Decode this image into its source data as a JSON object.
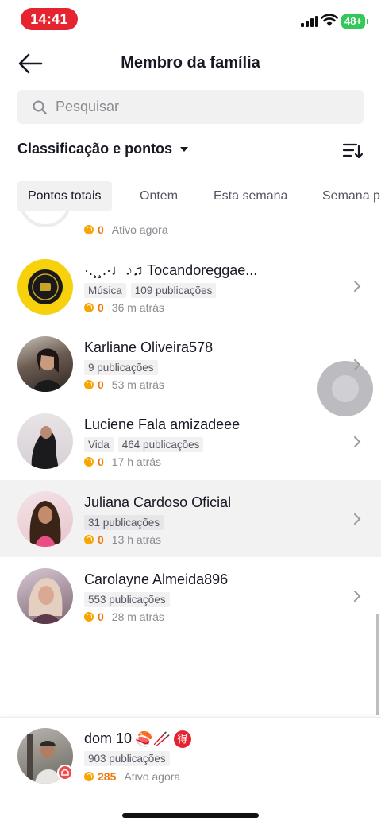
{
  "status_bar": {
    "time": "14:41",
    "battery": "48+"
  },
  "header": {
    "title": "Membro da família"
  },
  "search": {
    "placeholder": "Pesquisar"
  },
  "sort": {
    "label": "Classificação e pontos"
  },
  "tabs": [
    {
      "label": "Pontos totais",
      "active": true
    },
    {
      "label": "Ontem"
    },
    {
      "label": "Esta semana"
    },
    {
      "label": "Semana p"
    }
  ],
  "partial_row": {
    "points": "0",
    "activity": "Ativo agora"
  },
  "members": [
    {
      "name": "·.¸¸.·♩♪♫ Tocandoreggae...",
      "tags": [
        "Música",
        "109 publicações"
      ],
      "points": "0",
      "activity": "36 m atrás",
      "highlight": false
    },
    {
      "name": "Karliane Oliveira578",
      "tags": [
        "9 publicações"
      ],
      "points": "0",
      "activity": "53 m atrás",
      "highlight": false
    },
    {
      "name": "Luciene Fala amizadeee",
      "tags": [
        "Vida",
        "464 publicações"
      ],
      "points": "0",
      "activity": "17 h atrás",
      "highlight": false
    },
    {
      "name": "Juliana Cardoso Oficial",
      "tags": [
        "31 publicações"
      ],
      "points": "0",
      "activity": "13 h atrás",
      "highlight": true
    },
    {
      "name": "Carolayne Almeida896",
      "tags": [
        "553 publicações"
      ],
      "points": "0",
      "activity": "28 m atrás",
      "highlight": false
    }
  ],
  "self": {
    "name": "dom 10",
    "emojis": "🍣🥢",
    "badge_char": "得",
    "tags": [
      "903 publicações"
    ],
    "points": "285",
    "activity": "Ativo agora"
  },
  "colors": {
    "accent": "#f0780a",
    "coin": "#f7a500",
    "time_pill": "#e5242f",
    "battery": "#34c759"
  }
}
